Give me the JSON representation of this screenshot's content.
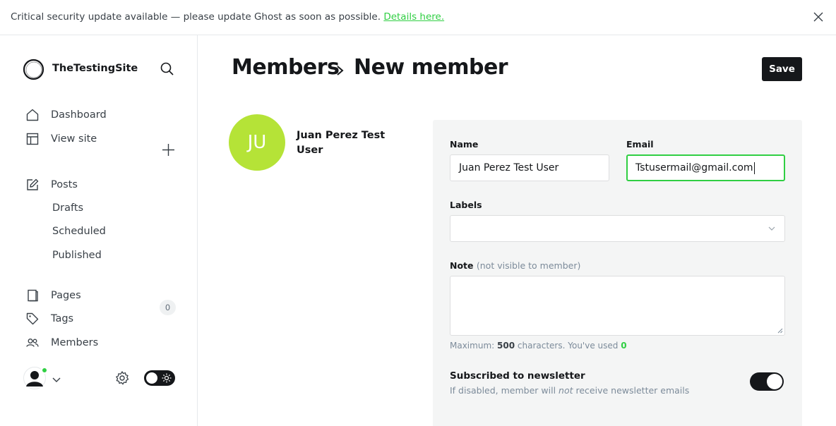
{
  "banner": {
    "text": "Critical security update available — please update Ghost as soon as possible.",
    "link": "Details here."
  },
  "sidebar": {
    "site_name": "TheTestingSite",
    "nav": {
      "dashboard": "Dashboard",
      "view_site": "View site",
      "posts": "Posts",
      "drafts": "Drafts",
      "scheduled": "Scheduled",
      "published": "Published",
      "pages": "Pages",
      "tags": "Tags",
      "members": "Members",
      "members_count": "0"
    }
  },
  "header": {
    "breadcrumb_parent": "Members",
    "title": "New member",
    "save_label": "Save"
  },
  "member": {
    "initials": "JU",
    "name": "Juan Perez Test User",
    "avatar_color": "#b5e337"
  },
  "form": {
    "name_label": "Name",
    "name_value": "Juan Perez Test User",
    "email_label": "Email",
    "email_value": "Tstusermail@gmail.com",
    "labels_label": "Labels",
    "labels_value": "",
    "note_label": "Note",
    "note_hint": "(not visible to member)",
    "note_value": "",
    "char_prefix": "Maximum:",
    "char_max": "500",
    "char_middle": "characters. You've used",
    "char_used": "0",
    "newsletter_title": "Subscribed to newsletter",
    "newsletter_desc_before": "If disabled, member will",
    "newsletter_desc_em": "not",
    "newsletter_desc_after": "receive newsletter emails",
    "newsletter_enabled": true
  },
  "colors": {
    "accent": "#30cf43",
    "dark": "#15171a"
  }
}
